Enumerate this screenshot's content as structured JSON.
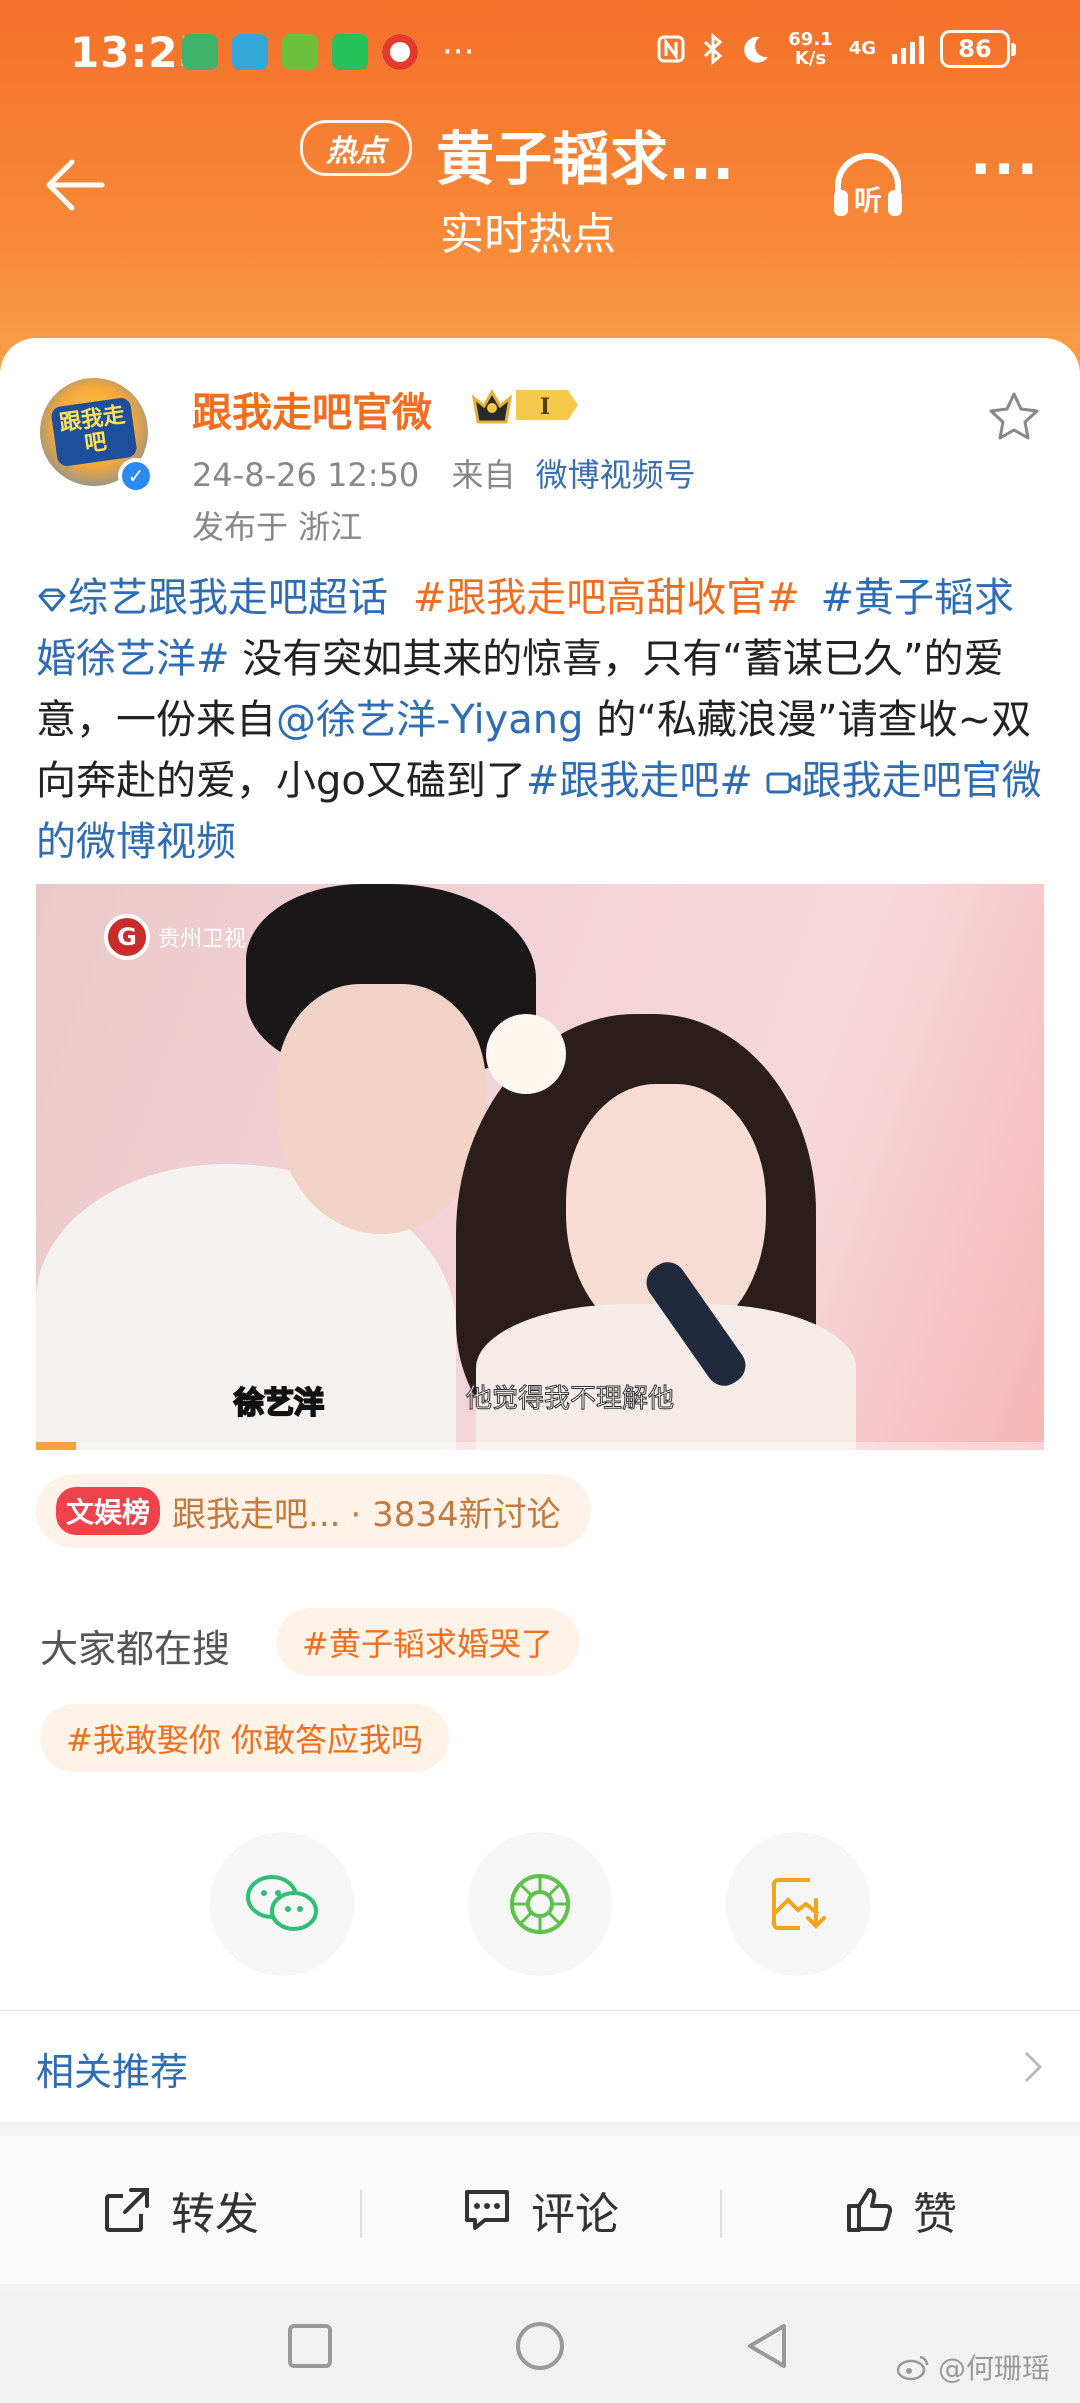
{
  "status_bar": {
    "time": "13:25",
    "net_speed_value": "69.1",
    "net_speed_unit": "K/s",
    "signal_type": "4G",
    "battery": "86",
    "overflow_dots": "···"
  },
  "header": {
    "hot_tag": "热点",
    "title": "黄子韬求...",
    "subtitle": "实时热点",
    "listen_label": "听"
  },
  "post": {
    "author": "跟我走吧官微",
    "vip_level": "I",
    "avatar_text": "跟我走吧",
    "timestamp": "24-8-26 12:50",
    "source_prefix": "来自",
    "source": "微博视频号",
    "location": "发布于 浙江",
    "supertopic": "综艺跟我走吧超话",
    "tag1": "#跟我走吧高甜收官#",
    "tag2": "#黄子韬求婚徐艺洋#",
    "text_a": " 没有突如其来的惊喜，只有“蓄谋已久”的爱意，一份来自",
    "mention": "@徐艺洋-Yiyang",
    "text_b": " 的“私藏浪漫”请查收~双向奔赴的爱，小go又磕到了",
    "tag3": "#跟我走吧#",
    "video_link": "跟我走吧官微的微博视频"
  },
  "video": {
    "channel": "贵州卫视",
    "subtitle_name": "徐艺洋",
    "subtitle_text": "他觉得我不理解他",
    "progress": 0.04
  },
  "rank": {
    "badge": "文娱榜",
    "name": "跟我走吧...",
    "discussion": "· 3834新讨论"
  },
  "searches": {
    "label": "大家都在搜",
    "chips": [
      "#黄子韬求婚哭了",
      "#我敢娶你 你敢答应我吗"
    ]
  },
  "share": [
    "wechat-icon",
    "moments-icon",
    "save-image-icon"
  ],
  "related": {
    "label": "相关推荐"
  },
  "actions": {
    "repost": "转发",
    "comment": "评论",
    "like": "赞"
  },
  "watermark": "@何珊瑶",
  "colors": {
    "brand_orange": "#f26d1e",
    "link_blue": "#2e6db4",
    "header_gradient_top": "#f5702a"
  }
}
